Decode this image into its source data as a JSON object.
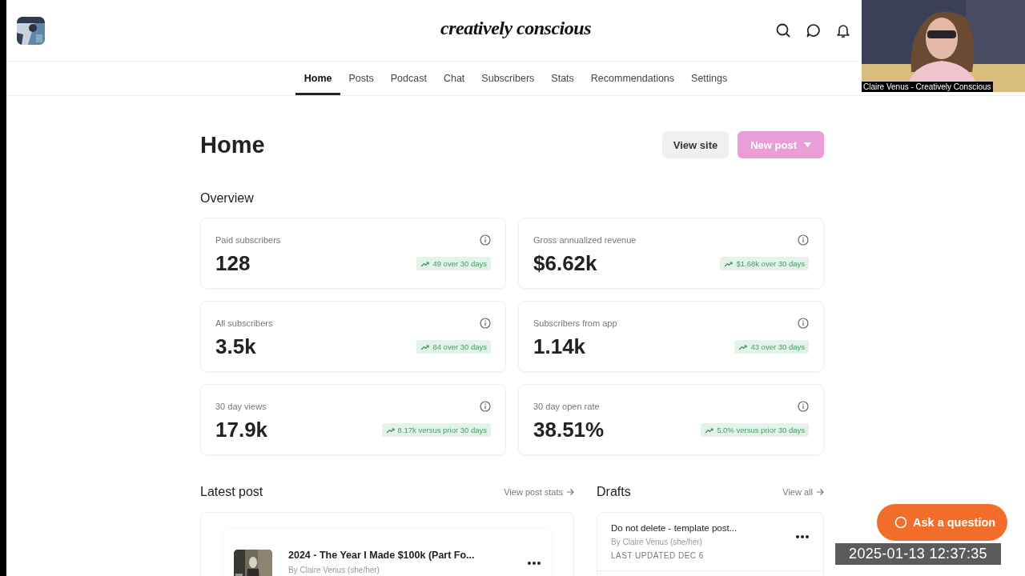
{
  "header": {
    "logo": "creatively conscious"
  },
  "nav": [
    {
      "label": "Home",
      "selected": true
    },
    {
      "label": "Posts",
      "selected": false
    },
    {
      "label": "Podcast",
      "selected": false
    },
    {
      "label": "Chat",
      "selected": false
    },
    {
      "label": "Subscribers",
      "selected": false
    },
    {
      "label": "Stats",
      "selected": false
    },
    {
      "label": "Recommendations",
      "selected": false
    },
    {
      "label": "Settings",
      "selected": false
    }
  ],
  "page": {
    "title": "Home",
    "buttons": [
      {
        "label": "View site",
        "kind": "secondary"
      },
      {
        "label": "New post",
        "kind": "primary"
      }
    ]
  },
  "overview": {
    "title": "Overview",
    "stats": [
      {
        "label": "Paid subscribers",
        "value": "128",
        "trend": "49 over 30 days"
      },
      {
        "label": "Gross annualized revenue",
        "value": "$6.62k",
        "trend": "$1.68k over 30 days"
      },
      {
        "label": "All subscribers",
        "value": "3.5k",
        "trend": "84 over 30 days"
      },
      {
        "label": "Subscribers from app",
        "value": "1.14k",
        "trend": "43 over 30 days"
      },
      {
        "label": "30 day views",
        "value": "17.9k",
        "trend": "8.17k versus prior 30 days"
      },
      {
        "label": "30 day open rate",
        "value": "38.51%",
        "trend": "5.0% versus prior 30 days"
      }
    ]
  },
  "latest_post": {
    "title": "Latest post",
    "link": "View post stats",
    "post": {
      "title": "2024 - The Year I Made $100k (Part Fo...",
      "author": "By Claire Venus (she/her)"
    }
  },
  "drafts": {
    "title": "Drafts",
    "link": "View all",
    "items": [
      {
        "title": "Do not delete - template post...",
        "author": "By Claire Venus (she/her)",
        "updated": "LAST UPDATED DEC 6"
      }
    ]
  },
  "help_button": {
    "label": "Ask a question"
  },
  "video_overlay": {
    "caption": "Claire Venus - Creatively Conscious"
  },
  "timestamp": "2025-01-13 12:37:35"
}
